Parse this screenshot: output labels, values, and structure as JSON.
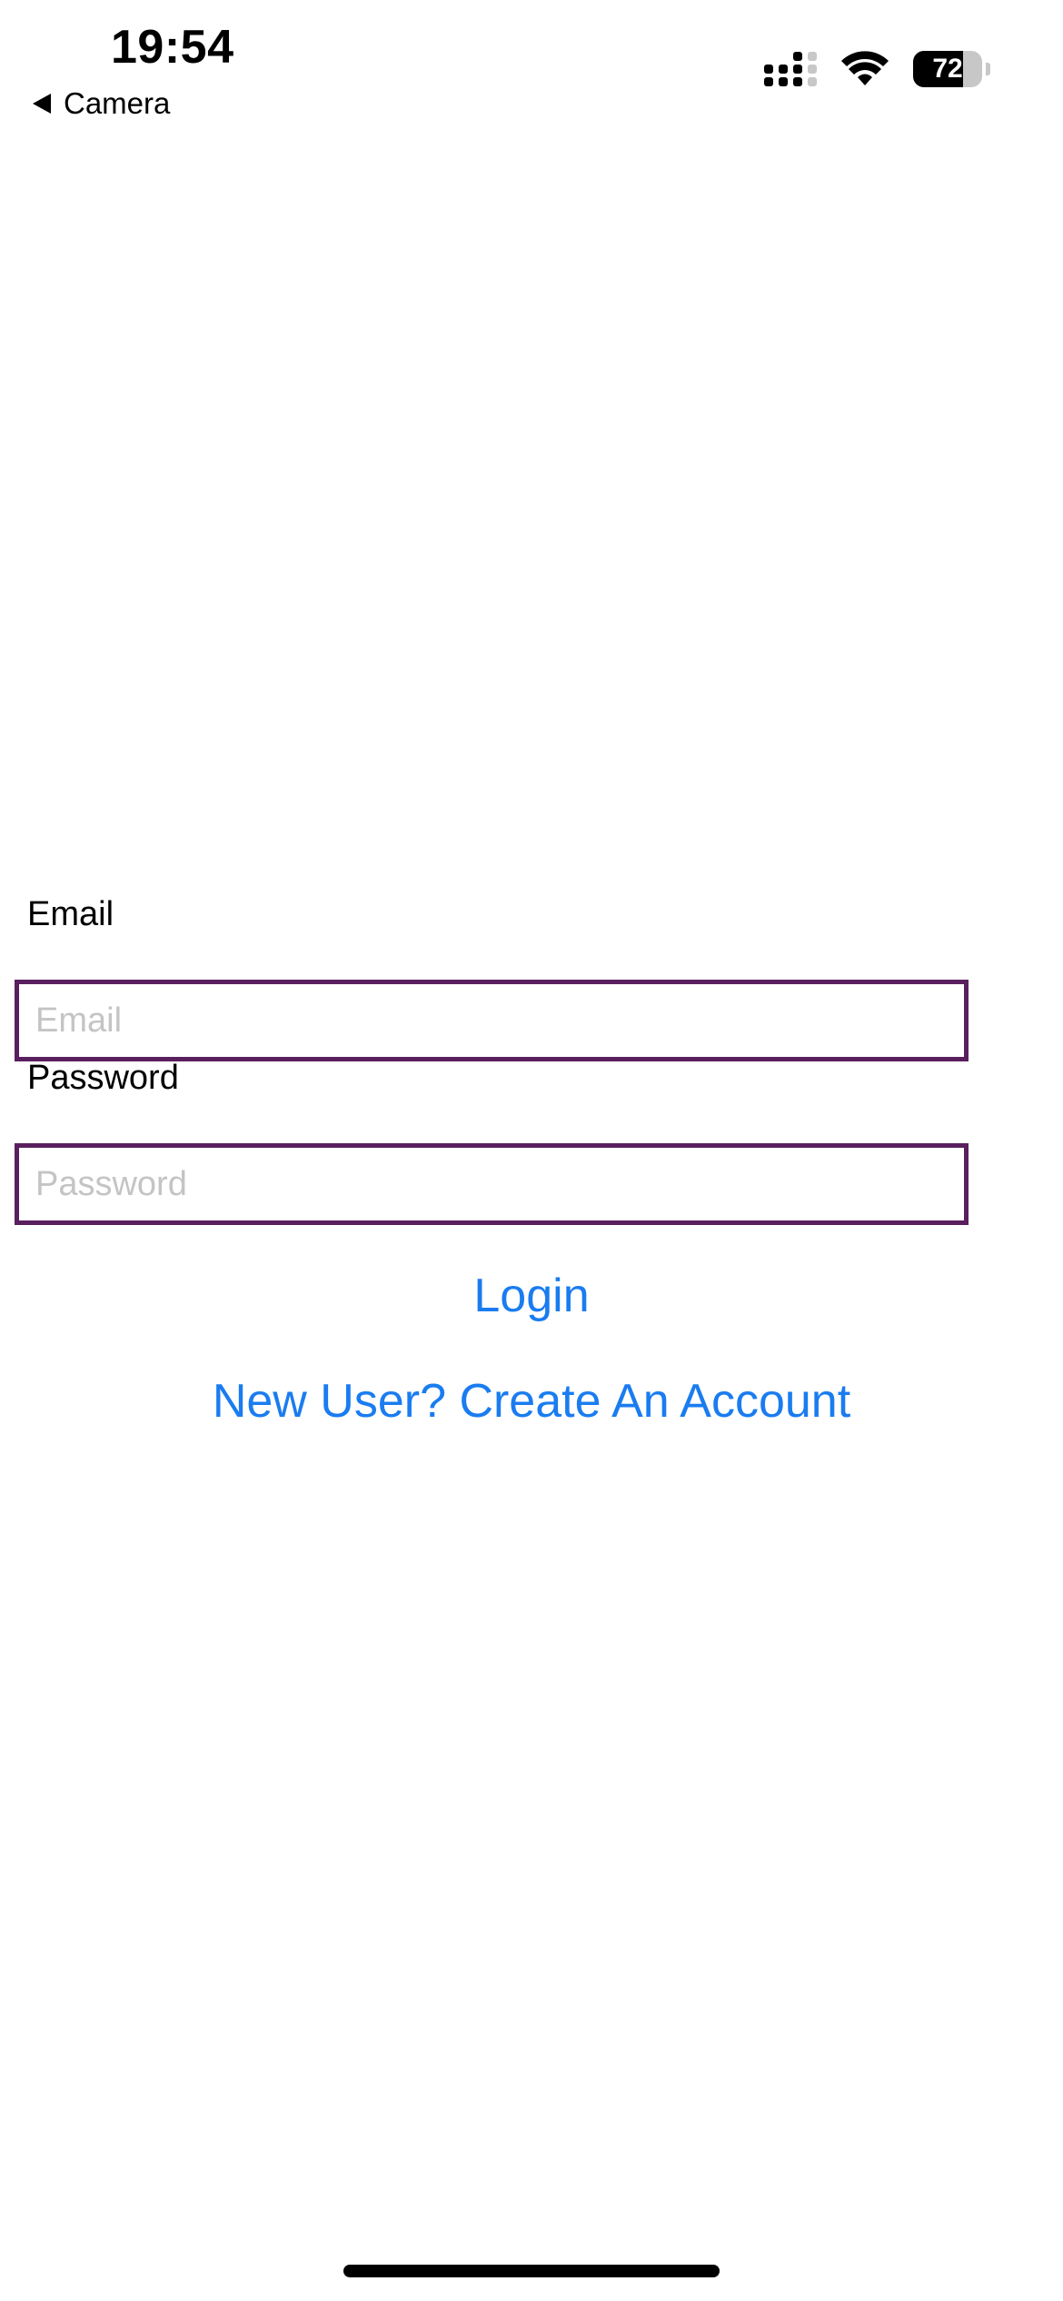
{
  "status_bar": {
    "time": "19:54",
    "back_label": "Camera",
    "battery_percent": "72",
    "battery_level": 0.72,
    "icons": [
      "signal-icon",
      "wifi-icon",
      "battery-icon"
    ]
  },
  "form": {
    "email_label": "Email",
    "email_placeholder": "Email",
    "email_value": "",
    "password_label": "Password",
    "password_placeholder": "Password",
    "password_value": "",
    "input_border_color": "#5a1f5e"
  },
  "actions": {
    "login_label": "Login",
    "create_account_label": "New User? Create An Account",
    "link_color": "#1a7cf0"
  }
}
